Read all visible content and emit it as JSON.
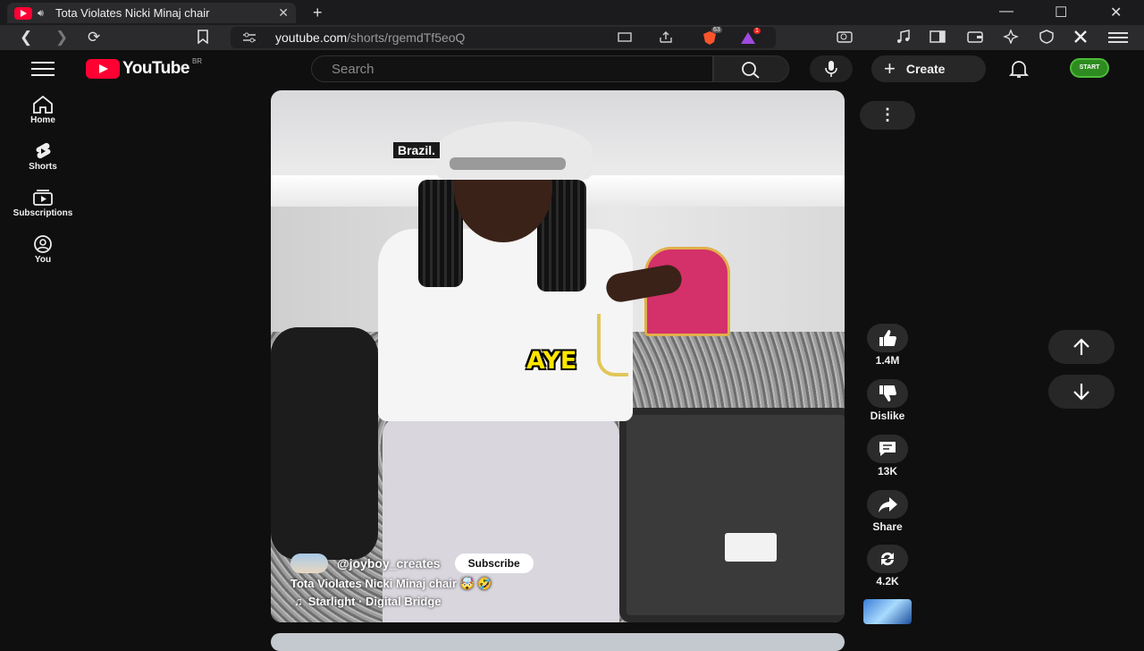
{
  "browser": {
    "tab_title": "Tota Violates Nicki Minaj chair",
    "url_host": "youtube.com",
    "url_path": "/shorts/rgemdTf5eoQ",
    "new_tab_glyph": "+",
    "ext_badges": {
      "brave_count": "63",
      "vpn_count": "1"
    }
  },
  "youtube": {
    "logo_text": "YouTube",
    "country_code": "BR",
    "search_placeholder": "Search",
    "create_label": "Create",
    "avatar_text": "START"
  },
  "guide": [
    {
      "label": "Home",
      "icon": "home-icon"
    },
    {
      "label": "Shorts",
      "icon": "shorts-icon"
    },
    {
      "label": "Subscriptions",
      "icon": "subscriptions-icon"
    },
    {
      "label": "You",
      "icon": "you-icon"
    }
  ],
  "short": {
    "caption_top": "Brazil.",
    "caption_center": "AYE",
    "channel_handle": "@joyboy_creates",
    "subscribe_label": "Subscribe",
    "title": "Tota Violates Nicki Minaj chair 🤯 🤣",
    "music": "Starlight · Digital Bridge"
  },
  "actions": {
    "like_count": "1.4M",
    "dislike_label": "Dislike",
    "comments_count": "13K",
    "share_label": "Share",
    "remix_count": "4.2K"
  },
  "colors": {
    "brand_red": "#ff0033",
    "background": "#0f0f0f",
    "caption_yellow": "#ffe600"
  }
}
